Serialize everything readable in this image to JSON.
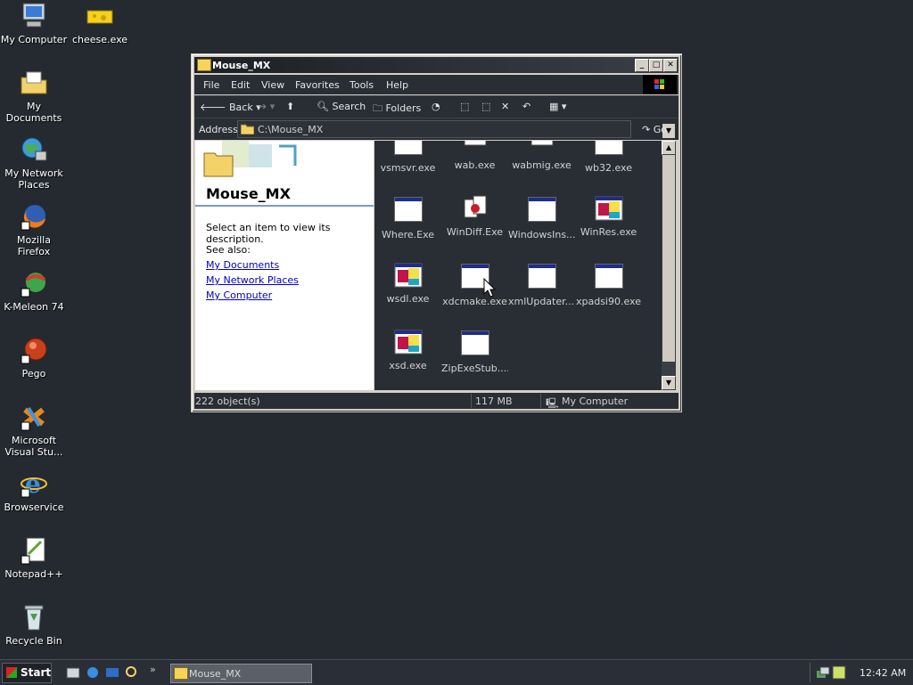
{
  "desktop": {
    "icons": [
      {
        "label": "My Computer",
        "icon": "my-computer-icon"
      },
      {
        "label": "cheese.exe",
        "icon": "cheese-icon"
      },
      {
        "label": "My Documents",
        "icon": "my-documents-icon"
      },
      {
        "label": "My Network Places",
        "icon": "network-icon"
      },
      {
        "label": "Mozilla Firefox",
        "icon": "firefox-icon"
      },
      {
        "label": "K-Meleon 74",
        "icon": "k-meleon-icon"
      },
      {
        "label": "Pego",
        "icon": "pego-icon"
      },
      {
        "label": "Microsoft Visual Stu...",
        "icon": "visual-studio-icon"
      },
      {
        "label": "Browservice",
        "icon": "ie-icon"
      },
      {
        "label": "Notepad++",
        "icon": "notepad-icon"
      },
      {
        "label": "Recycle Bin",
        "icon": "recycle-bin-icon"
      }
    ]
  },
  "window": {
    "title": "Mouse_MX",
    "menu": [
      "File",
      "Edit",
      "View",
      "Favorites",
      "Tools",
      "Help"
    ],
    "toolbar": {
      "back": "Back",
      "search": "Search",
      "folders": "Folders"
    },
    "address": {
      "label": "Address",
      "value": "C:\\Mouse_MX",
      "go": "Go"
    },
    "left_panel": {
      "title": "Mouse_MX",
      "description": "Select an item to view its description.",
      "see_also": "See also:",
      "links": [
        "My Documents",
        "My Network Places",
        "My Computer"
      ]
    },
    "files": [
      {
        "label": "vsmsvr.exe",
        "type": "app"
      },
      {
        "label": "wab.exe",
        "type": "book"
      },
      {
        "label": "wabmig.exe",
        "type": "book"
      },
      {
        "label": "wb32.exe",
        "type": "app"
      },
      {
        "label": "Where.Exe",
        "type": "app"
      },
      {
        "label": "WinDiff.Exe",
        "type": "diff"
      },
      {
        "label": "WindowsIns...",
        "type": "app"
      },
      {
        "label": "WinRes.exe",
        "type": "color"
      },
      {
        "label": "wsdl.exe",
        "type": "color"
      },
      {
        "label": "xdcmake.exe",
        "type": "app"
      },
      {
        "label": "xmlUpdater....",
        "type": "app"
      },
      {
        "label": "xpadsi90.exe",
        "type": "app"
      },
      {
        "label": "xsd.exe",
        "type": "color"
      },
      {
        "label": "ZipExeStub....",
        "type": "app"
      }
    ],
    "status": {
      "objects": "222 object(s)",
      "size": "117 MB",
      "location": "My Computer"
    }
  },
  "taskbar": {
    "start": "Start",
    "task": "Mouse_MX",
    "clock": "12:42 AM"
  }
}
